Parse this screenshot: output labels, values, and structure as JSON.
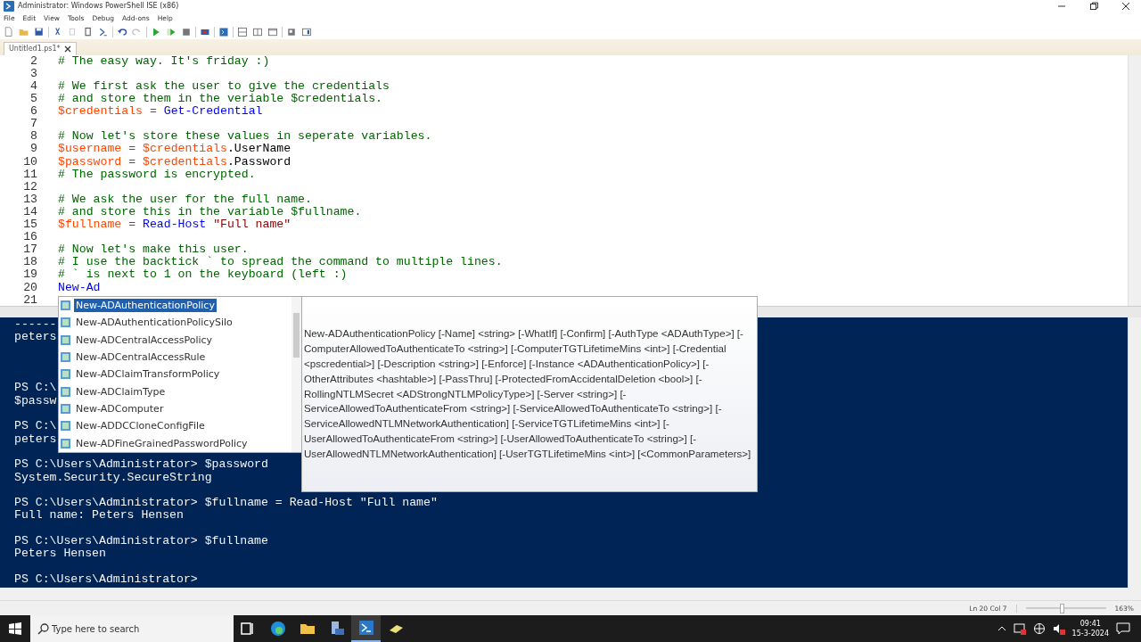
{
  "window": {
    "title": "Administrator: Windows PowerShell ISE (x86)"
  },
  "menu": [
    "File",
    "Edit",
    "View",
    "Tools",
    "Debug",
    "Add-ons",
    "Help"
  ],
  "tabs": [
    {
      "label": "Untitled1.ps1*",
      "selected": true
    }
  ],
  "editor": {
    "lines": [
      {
        "number": "2",
        "tokens": [
          {
            "kind": "comment",
            "text": "# The easy way. It's friday :)"
          }
        ]
      },
      {
        "number": "3"
      },
      {
        "number": "4",
        "tokens": [
          {
            "kind": "comment",
            "text": "# We first ask the user to give the credentials"
          }
        ]
      },
      {
        "number": "5",
        "tokens": [
          {
            "kind": "comment",
            "text": "# and store them in the veriable $credentials."
          }
        ]
      },
      {
        "number": "6",
        "tokens": [
          {
            "kind": "variable",
            "text": "$credentials"
          },
          {
            "kind": "operator",
            "text": " = "
          },
          {
            "kind": "command",
            "text": "Get-Credential"
          }
        ]
      },
      {
        "number": "7"
      },
      {
        "number": "8",
        "tokens": [
          {
            "kind": "comment",
            "text": "# Now let's store these values in seperate variables."
          }
        ]
      },
      {
        "number": "9",
        "tokens": [
          {
            "kind": "variable",
            "text": "$username"
          },
          {
            "kind": "operator",
            "text": " = "
          },
          {
            "kind": "variable",
            "text": "$credentials"
          },
          {
            "kind": "member",
            "text": ".UserName"
          }
        ]
      },
      {
        "number": "10",
        "tokens": [
          {
            "kind": "variable",
            "text": "$password"
          },
          {
            "kind": "operator",
            "text": " = "
          },
          {
            "kind": "variable",
            "text": "$credentials"
          },
          {
            "kind": "member",
            "text": ".Password"
          }
        ]
      },
      {
        "number": "11",
        "tokens": [
          {
            "kind": "comment",
            "text": "# The password is encrypted."
          }
        ]
      },
      {
        "number": "12"
      },
      {
        "number": "13",
        "tokens": [
          {
            "kind": "comment",
            "text": "# We ask the user for the full name."
          }
        ]
      },
      {
        "number": "14",
        "tokens": [
          {
            "kind": "comment",
            "text": "# and store this in the variable $fullname."
          }
        ]
      },
      {
        "number": "15",
        "tokens": [
          {
            "kind": "variable",
            "text": "$fullname"
          },
          {
            "kind": "operator",
            "text": " = "
          },
          {
            "kind": "command",
            "text": "Read-Host"
          },
          {
            "kind": "string",
            "text": " \"Full name\""
          }
        ]
      },
      {
        "number": "16"
      },
      {
        "number": "17",
        "tokens": [
          {
            "kind": "comment",
            "text": "# Now let's make this user."
          }
        ]
      },
      {
        "number": "18",
        "tokens": [
          {
            "kind": "comment",
            "text": "# I use the backtick ` to spread the command to multiple lines."
          }
        ]
      },
      {
        "number": "19",
        "tokens": [
          {
            "kind": "comment",
            "text": "# ` is next to 1 on the keyboard (left :)"
          }
        ]
      },
      {
        "number": "20",
        "tokens": [
          {
            "kind": "command",
            "text": "New-Ad"
          }
        ]
      },
      {
        "number": "21"
      }
    ]
  },
  "console": {
    "lines": [
      {
        "kind": "text",
        "text": "------"
      },
      {
        "kind": "text",
        "text": "peters"
      },
      {
        "kind": "blank"
      },
      {
        "kind": "blank"
      },
      {
        "kind": "blank"
      },
      {
        "kind": "text",
        "text": "PS C:\\"
      },
      {
        "kind": "text",
        "text": "$passw"
      },
      {
        "kind": "blank"
      },
      {
        "kind": "text",
        "text": "PS C:\\"
      },
      {
        "kind": "text",
        "text": "peters"
      },
      {
        "kind": "blank"
      },
      {
        "kind": "text",
        "text": "PS C:\\Users\\Administrator> $password"
      },
      {
        "kind": "text",
        "text": "System.Security.SecureString"
      },
      {
        "kind": "blank"
      },
      {
        "kind": "text",
        "text": "PS C:\\Users\\Administrator> $fullname = Read-Host \"Full name\""
      },
      {
        "kind": "text",
        "text": "Full name: Peters Hensen"
      },
      {
        "kind": "blank"
      },
      {
        "kind": "text",
        "text": "PS C:\\Users\\Administrator> $fullname"
      },
      {
        "kind": "text",
        "text": "Peters Hensen"
      },
      {
        "kind": "blank"
      },
      {
        "kind": "text",
        "text": "PS C:\\Users\\Administrator>"
      }
    ]
  },
  "completion": {
    "items": [
      {
        "label": "New-ADAuthenticationPolicy",
        "selected": true
      },
      {
        "label": "New-ADAuthenticationPolicySilo",
        "selected": false
      },
      {
        "label": "New-ADCentralAccessPolicy",
        "selected": false
      },
      {
        "label": "New-ADCentralAccessRule",
        "selected": false
      },
      {
        "label": "New-ADClaimTransformPolicy",
        "selected": false
      },
      {
        "label": "New-ADClaimType",
        "selected": false
      },
      {
        "label": "New-ADComputer",
        "selected": false
      },
      {
        "label": "New-ADDCCloneConfigFile",
        "selected": false
      },
      {
        "label": "New-ADFineGrainedPasswordPolicy",
        "selected": false
      }
    ],
    "tooltip": "New-ADAuthenticationPolicy [-Name] <string> [-WhatIf] [-Confirm] [-AuthType <ADAuthType>] [-ComputerAllowedToAuthenticateTo <string>] [-ComputerTGTLifetimeMins <int>] [-Credential <pscredential>] [-Description <string>] [-Enforce] [-Instance <ADAuthenticationPolicy>] [-OtherAttributes <hashtable>] [-PassThru] [-ProtectedFromAccidentalDeletion <bool>] [-RollingNTLMSecret <ADStrongNTLMPolicyType>] [-Server <string>] [-ServiceAllowedToAuthenticateFrom <string>] [-ServiceAllowedToAuthenticateTo <string>] [-ServiceAllowedNTLMNetworkAuthentication] [-ServiceTGTLifetimeMins <int>] [-UserAllowedToAuthenticateFrom <string>] [-UserAllowedToAuthenticateTo <string>] [-UserAllowedNTLMNetworkAuthentication] [-UserTGTLifetimeMins <int>] [<CommonParameters>]"
  },
  "status_bar": {
    "position": "Ln 20  Col 7",
    "zoom": {
      "level": 0.45
    },
    "zoom_text": "163%"
  },
  "taskbar": {
    "search": {
      "placeholder": "Type here to search"
    },
    "time": "09:41",
    "date": "15-3-2024"
  }
}
